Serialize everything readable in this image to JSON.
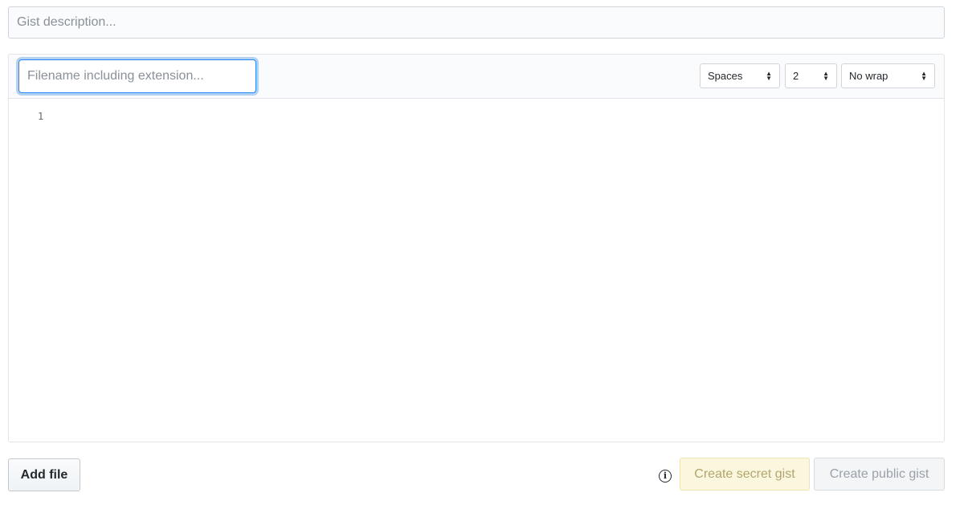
{
  "description": {
    "placeholder": "Gist description...",
    "value": ""
  },
  "file": {
    "filename_placeholder": "Filename including extension...",
    "filename_value": "",
    "indent_mode": "Spaces",
    "indent_size": "2",
    "wrap_mode": "No wrap",
    "line_numbers": [
      "1"
    ]
  },
  "actions": {
    "add_file_label": "Add file",
    "info_icon": "info-circle-icon",
    "create_secret_label": "Create secret gist",
    "create_public_label": "Create public gist"
  },
  "colors": {
    "focus_ring": "#2188ff",
    "secret_button_bg": "#fbf6de",
    "public_button_bg": "#f3f5f7"
  }
}
